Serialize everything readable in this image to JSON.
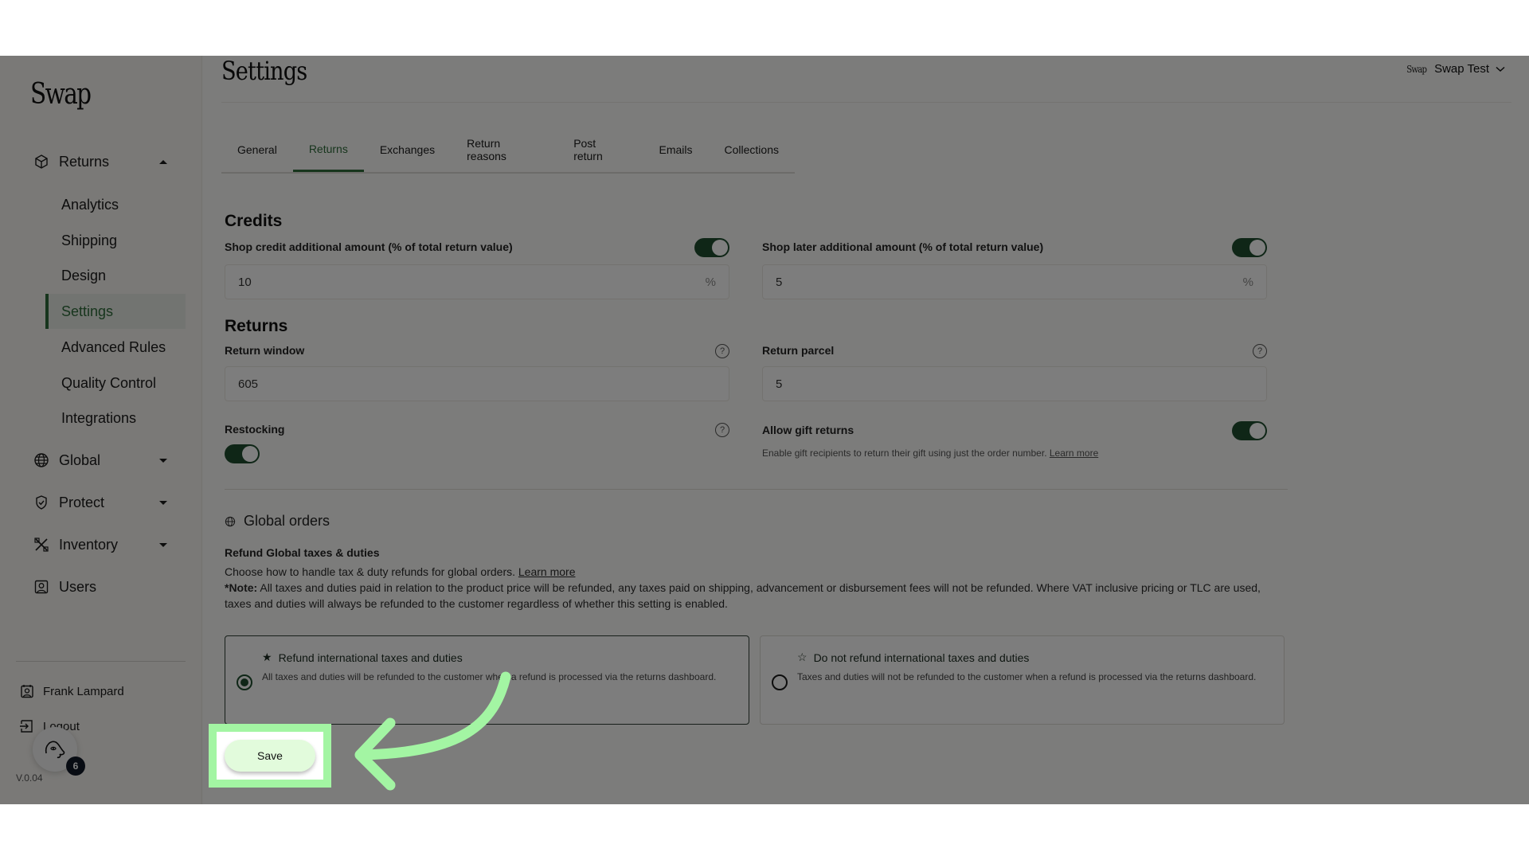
{
  "app": {
    "logo": "Swap",
    "version": "V.0.04",
    "notification_count": "6"
  },
  "sidebar": {
    "groups": [
      {
        "label": "Returns",
        "icon": "box-icon",
        "expanded": true
      },
      {
        "label": "Global",
        "icon": "globe-icon",
        "expanded": false
      },
      {
        "label": "Protect",
        "icon": "shield-check-icon",
        "expanded": false
      },
      {
        "label": "Inventory",
        "icon": "tools-icon",
        "expanded": false
      },
      {
        "label": "Users",
        "icon": "user-badge-icon"
      }
    ],
    "returns_items": [
      {
        "label": "Analytics"
      },
      {
        "label": "Shipping"
      },
      {
        "label": "Design"
      },
      {
        "label": "Settings",
        "active": true
      },
      {
        "label": "Advanced Rules"
      },
      {
        "label": "Quality Control"
      },
      {
        "label": "Integrations"
      }
    ],
    "user_name": "Frank Lampard",
    "logout_label": "Logout"
  },
  "header": {
    "title": "Settings",
    "store_logo": "Swap",
    "store_name": "Swap Test"
  },
  "tabs": [
    {
      "label": "General"
    },
    {
      "label": "Returns",
      "active": true
    },
    {
      "label": "Exchanges"
    },
    {
      "label": "Return reasons"
    },
    {
      "label": "Post return"
    },
    {
      "label": "Emails"
    },
    {
      "label": "Collections"
    }
  ],
  "credits": {
    "title": "Credits",
    "shop_credit": {
      "label": "Shop credit additional amount (% of total return value)",
      "value": "10",
      "suffix": "%",
      "enabled": true
    },
    "shop_later": {
      "label": "Shop later additional amount (% of total return value)",
      "value": "5",
      "suffix": "%",
      "enabled": true
    }
  },
  "returns": {
    "title": "Returns",
    "return_window": {
      "label": "Return window",
      "value": "605",
      "help": "?"
    },
    "return_parcel": {
      "label": "Return parcel",
      "value": "5",
      "help": "?"
    },
    "restocking": {
      "label": "Restocking",
      "enabled": true,
      "help": "?"
    },
    "gift_returns": {
      "label": "Allow gift returns",
      "enabled": true,
      "description": "Enable gift recipients to return their gift using just the order number.",
      "link": "Learn more"
    }
  },
  "global_orders": {
    "title": "Global orders",
    "subtitle": "Refund Global taxes & duties",
    "description": "Choose how to handle tax & duty refunds for global orders.",
    "link": "Learn more",
    "note_label": "*Note:",
    "note_text": "All taxes and duties paid in relation to the product price will be refunded, any taxes paid on shipping, advancement or disbursement fees will not be refunded. Where VAT inclusive pricing or TLC are used, taxes and duties will always be refunded to the customer regardless of whether this setting is enabled.",
    "options": [
      {
        "title": "Refund international taxes and duties",
        "description": "All taxes and duties will be refunded to the customer when a refund is processed via the returns dashboard.",
        "selected": true,
        "icon": "★"
      },
      {
        "title": "Do not refund international taxes and duties",
        "description": "Taxes and duties will not be refunded to the customer when a refund is processed via the returns dashboard.",
        "selected": false,
        "icon": "☆"
      }
    ]
  },
  "actions": {
    "save_label": "Save"
  },
  "colors": {
    "accent": "#2e6b3a",
    "toggle_on": "#1f4d2e",
    "highlight": "#a3f5a3"
  }
}
